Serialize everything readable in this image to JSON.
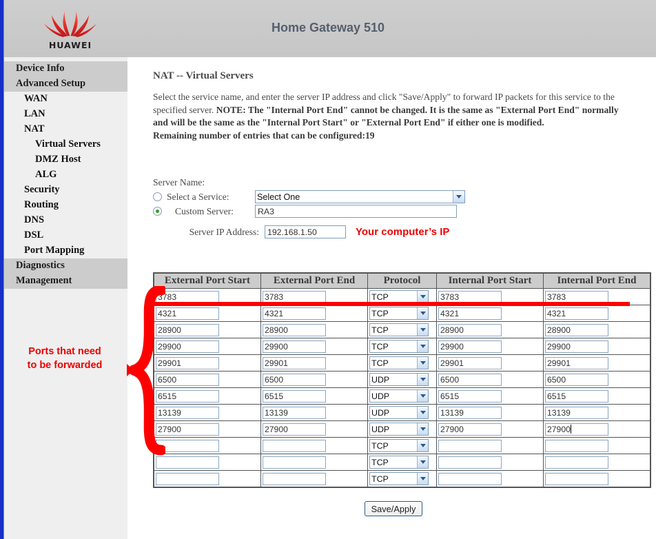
{
  "header": {
    "title": "Home Gateway 510",
    "brand": "HUAWEI",
    "logo_icon": "huawei-flower-logo"
  },
  "sidebar": {
    "items": [
      {
        "label": "Device Info",
        "level": "top"
      },
      {
        "label": "Advanced Setup",
        "level": "top"
      },
      {
        "label": "WAN",
        "level": "l1"
      },
      {
        "label": "LAN",
        "level": "l1"
      },
      {
        "label": "NAT",
        "level": "l1"
      },
      {
        "label": "Virtual Servers",
        "level": "l2"
      },
      {
        "label": "DMZ Host",
        "level": "l2"
      },
      {
        "label": "ALG",
        "level": "l2"
      },
      {
        "label": "Security",
        "level": "l1"
      },
      {
        "label": "Routing",
        "level": "l1"
      },
      {
        "label": "DNS",
        "level": "l1"
      },
      {
        "label": "DSL",
        "level": "l1"
      },
      {
        "label": "Port Mapping",
        "level": "l1"
      },
      {
        "label": "Diagnostics",
        "level": "top"
      },
      {
        "label": "Management",
        "level": "top"
      }
    ]
  },
  "main": {
    "page_title": "NAT -- Virtual Servers",
    "intro_part1": "Select the service name, and enter the server IP address and click \"Save/Apply\" to forward IP packets for this service to the specified server. ",
    "intro_bold": "NOTE: The \"Internal Port End\" cannot be changed. It is the same as \"External Port End\" normally and will be the same as the \"Internal Port Start\" or \"External Port End\" if either one is modified.",
    "intro_remaining": "Remaining number of entries that can be configured:19",
    "server_name_label": "Server Name:",
    "select_service_label": "Select a Service:",
    "custom_server_label": "Custom Server:",
    "server_ip_label": "Server IP Address:",
    "select_service_value": "Select One",
    "select_service_options": [
      "Select One"
    ],
    "custom_server_value": "RA3",
    "server_ip_value": "192.168.1.50",
    "ip_annotation": "Your computer’s IP",
    "save_apply_label": "Save/Apply"
  },
  "table": {
    "headers": [
      "External Port Start",
      "External Port End",
      "Protocol",
      "Internal Port Start",
      "Internal Port End"
    ],
    "protocol_options": [
      "TCP",
      "UDP"
    ],
    "rows": [
      {
        "ext_start": "3783",
        "ext_end": "3783",
        "protocol": "TCP",
        "int_start": "3783",
        "int_end": "3783",
        "caret": false
      },
      {
        "ext_start": "4321",
        "ext_end": "4321",
        "protocol": "TCP",
        "int_start": "4321",
        "int_end": "4321",
        "caret": false
      },
      {
        "ext_start": "28900",
        "ext_end": "28900",
        "protocol": "TCP",
        "int_start": "28900",
        "int_end": "28900",
        "caret": false
      },
      {
        "ext_start": "29900",
        "ext_end": "29900",
        "protocol": "TCP",
        "int_start": "29900",
        "int_end": "29900",
        "caret": false
      },
      {
        "ext_start": "29901",
        "ext_end": "29901",
        "protocol": "TCP",
        "int_start": "29901",
        "int_end": "29901",
        "caret": false
      },
      {
        "ext_start": "6500",
        "ext_end": "6500",
        "protocol": "UDP",
        "int_start": "6500",
        "int_end": "6500",
        "caret": false
      },
      {
        "ext_start": "6515",
        "ext_end": "6515",
        "protocol": "UDP",
        "int_start": "6515",
        "int_end": "6515",
        "caret": false
      },
      {
        "ext_start": "13139",
        "ext_end": "13139",
        "protocol": "UDP",
        "int_start": "13139",
        "int_end": "13139",
        "caret": false
      },
      {
        "ext_start": "27900",
        "ext_end": "27900",
        "protocol": "UDP",
        "int_start": "27900",
        "int_end": "27900",
        "caret": true
      },
      {
        "ext_start": "",
        "ext_end": "",
        "protocol": "TCP",
        "int_start": "",
        "int_end": "",
        "caret": false
      },
      {
        "ext_start": "",
        "ext_end": "",
        "protocol": "TCP",
        "int_start": "",
        "int_end": "",
        "caret": false
      },
      {
        "ext_start": "",
        "ext_end": "",
        "protocol": "TCP",
        "int_start": "",
        "int_end": "",
        "caret": false
      }
    ]
  },
  "annotations": {
    "brace_label_line1": "Ports that need",
    "brace_label_line2": "to be forwarded",
    "red_color": "#ff0000",
    "note_color": "#ee0000"
  }
}
